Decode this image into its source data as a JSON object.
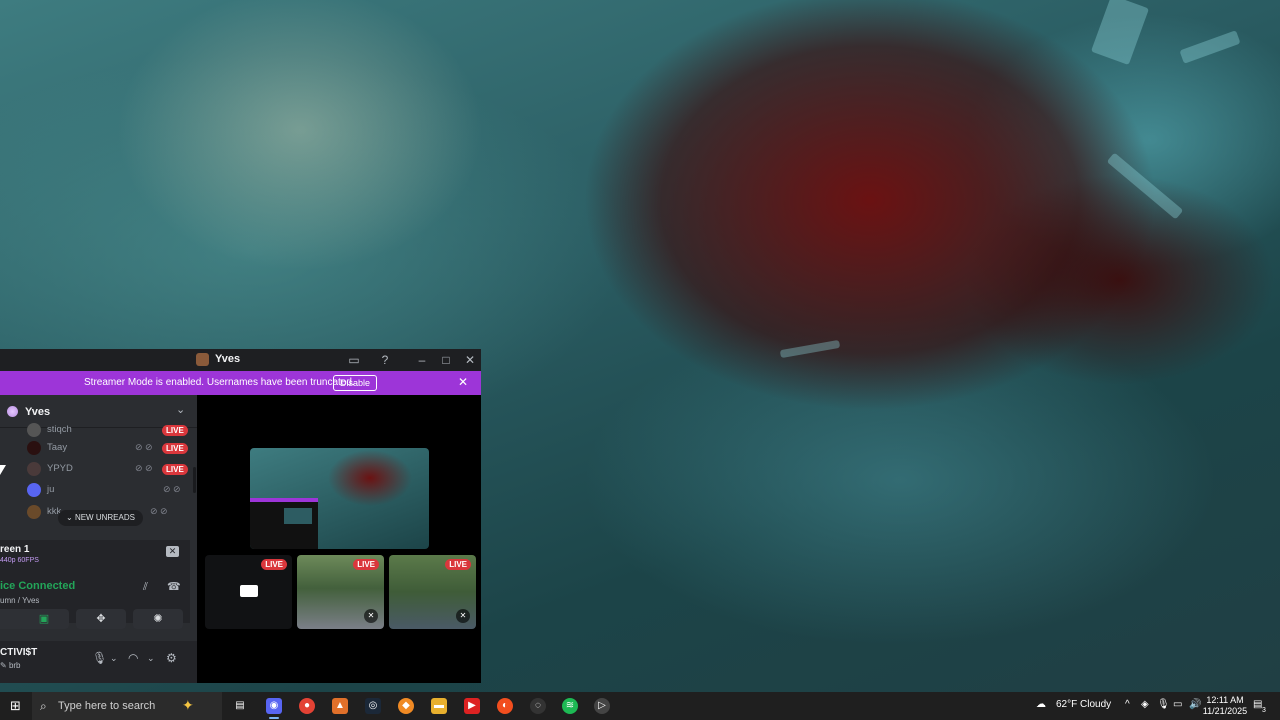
{
  "window": {
    "title": "Yves",
    "controls": [
      "inbox-icon",
      "help-icon",
      "minimize-icon",
      "maximize-icon",
      "close-icon"
    ]
  },
  "banner": {
    "text": "Streamer Mode is enabled. Usernames have been truncated.",
    "disable_label": "Disable"
  },
  "sidebar": {
    "server_name": "Yves",
    "members": [
      {
        "name": "stiqch",
        "live": "LIVE"
      },
      {
        "name": "Taay",
        "live": "LIVE"
      },
      {
        "name": "YPYD",
        "live": "LIVE"
      },
      {
        "name": "ju",
        "live": ""
      },
      {
        "name": "kkk",
        "live": ""
      }
    ],
    "new_unreads_label": "NEW UNREADS"
  },
  "screen_share": {
    "title": "reen 1",
    "quality": "440p 60FPS"
  },
  "voice": {
    "status": "ice Connected",
    "channel": "umn / Yves"
  },
  "user": {
    "name": "CTIVI$T",
    "status": "brb"
  },
  "stage": {
    "live_label": "LIVE"
  },
  "taskbar": {
    "search_placeholder": "Type here to search",
    "weather": "62°F  Cloudy",
    "time": "12:11 AM",
    "date": "11/21/2025",
    "notifications": "3"
  },
  "colors": {
    "banner": "#9d35d8",
    "live": "#da373c",
    "voice_connected": "#23a559",
    "quality_text": "#c29bf2"
  }
}
